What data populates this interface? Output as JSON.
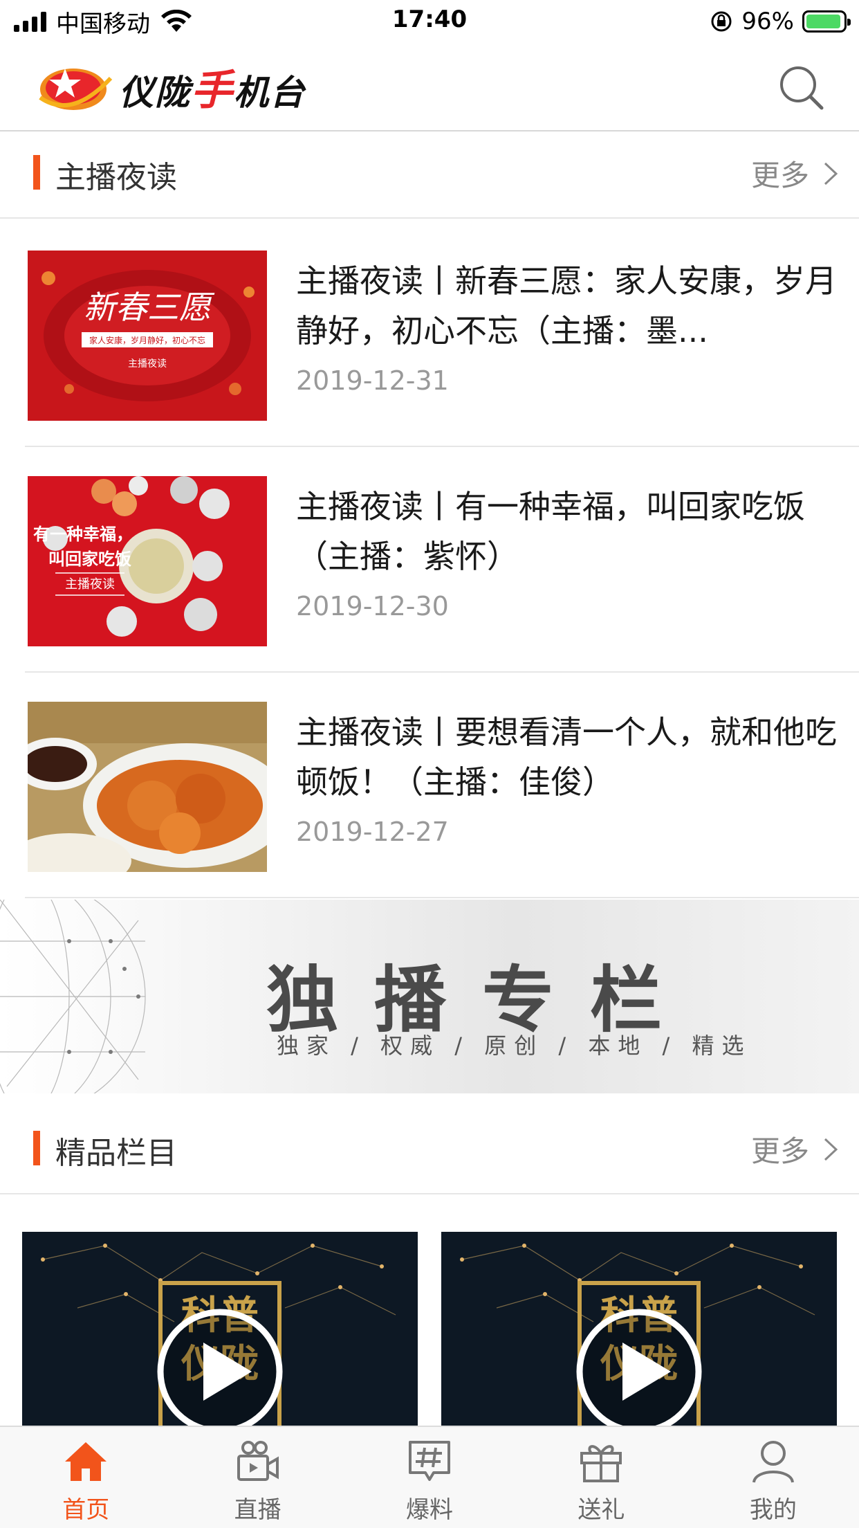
{
  "status_bar": {
    "carrier": "中国移动",
    "time": "17:40",
    "battery_percent": "96%"
  },
  "header": {
    "logo_text_1": "仪陇",
    "logo_text_2": "手",
    "logo_text_3": "机台"
  },
  "sections": {
    "reading": {
      "title": "主播夜读",
      "more_label": "更多"
    },
    "featured": {
      "title": "精品栏目",
      "more_label": "更多"
    }
  },
  "news": [
    {
      "title": "主播夜读丨新春三愿：家人安康，岁月静好，初心不忘（主播：墨...",
      "date": "2019-12-31",
      "thumb_title": "新春三愿",
      "thumb_caption": "家人安康，岁月静好，初心不忘",
      "thumb_sub": "主播夜读"
    },
    {
      "title": "主播夜读丨有一种幸福，叫回家吃饭（主播：紫怀）",
      "date": "2019-12-30",
      "thumb_title_1": "有一种幸福，",
      "thumb_title_2": "叫回家吃饭",
      "thumb_sub": "主播夜读"
    },
    {
      "title": "主播夜读丨要想看清一个人，就和他吃顿饭！（主播：佳俊）",
      "date": "2019-12-27"
    }
  ],
  "banner": {
    "title": "独播专栏",
    "subtitle": "独家 / 权威 / 原创 / 本地 / 精选"
  },
  "video_cards": [
    {
      "badge_1": "科普",
      "badge_2": "仪陇"
    },
    {
      "badge_1": "科普",
      "badge_2": "仪陇"
    }
  ],
  "tabs": [
    {
      "label": "首页",
      "icon": "home-icon",
      "active": true
    },
    {
      "label": "直播",
      "icon": "video-camera-icon",
      "active": false
    },
    {
      "label": "爆料",
      "icon": "hashtag-chat-icon",
      "active": false
    },
    {
      "label": "送礼",
      "icon": "gift-icon",
      "active": false
    },
    {
      "label": "我的",
      "icon": "user-icon",
      "active": false
    }
  ],
  "colors": {
    "accent": "#f2541b",
    "brand_red": "#e8262b"
  }
}
